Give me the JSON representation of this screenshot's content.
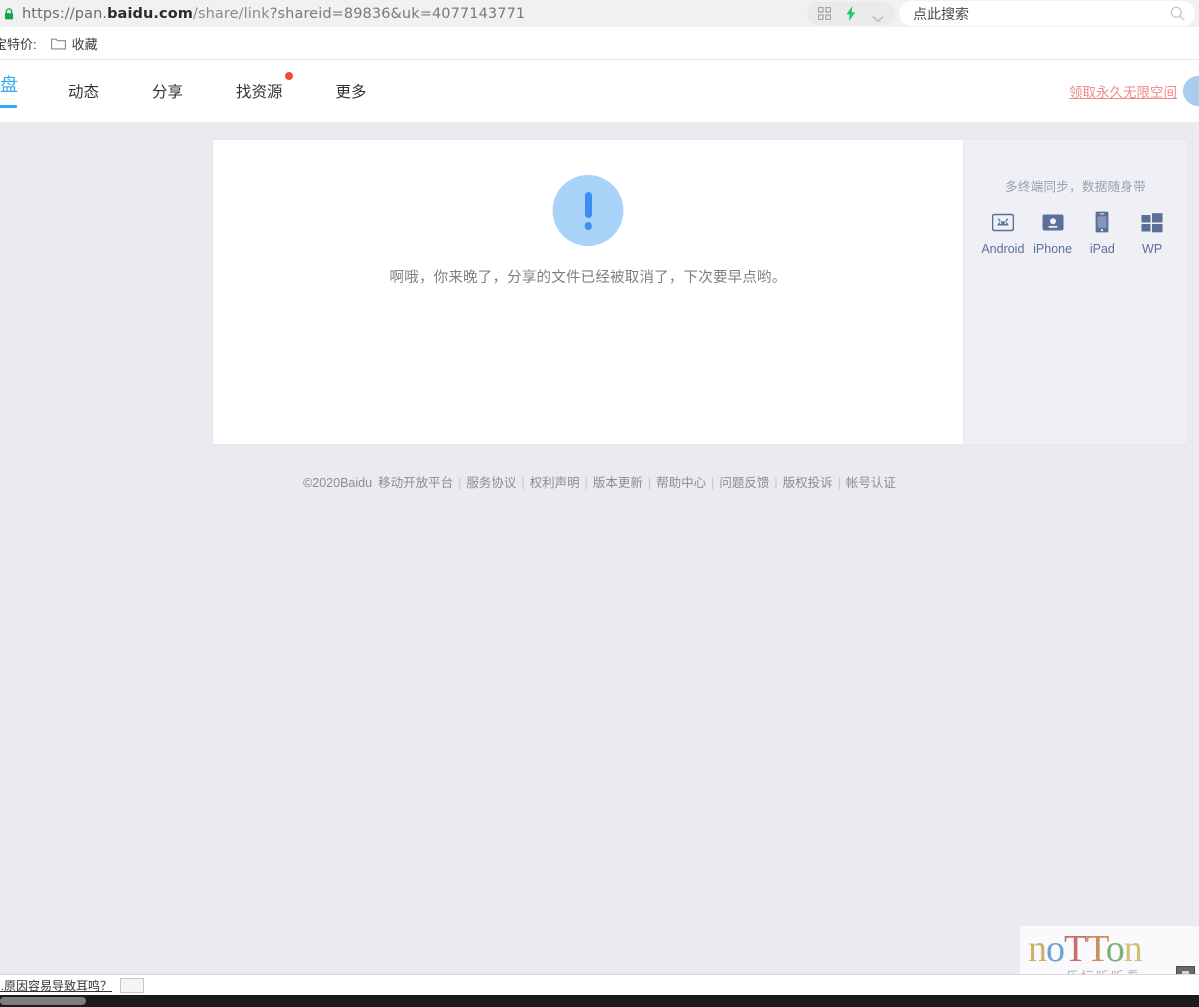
{
  "browser": {
    "url": {
      "scheme": "https://pan.",
      "domain": "baidu.com",
      "path": "/share/link",
      "query": "?shareid=89836&uk=4077143771",
      "full": "https://pan.baidu.com/share/link?shareid=89836&uk=4077143771"
    },
    "lock_icon": "secure-lock-icon",
    "omni_actions": {
      "qr_icon": "qr-code-icon",
      "bolt_icon": "lightning-bolt-icon",
      "chevron_icon": "chevron-down-icon"
    },
    "search": {
      "placeholder": "点此搜索",
      "icon": "search-magnifier-icon"
    },
    "bookmarks": [
      {
        "label": "宝特价:",
        "icon": null
      },
      {
        "label": "收藏",
        "icon": "folder-icon"
      }
    ]
  },
  "site_nav": {
    "brand": "盘",
    "items": [
      {
        "label": "动态",
        "badge": false
      },
      {
        "label": "分享",
        "badge": false
      },
      {
        "label": "找资源",
        "badge": true
      },
      {
        "label": "更多",
        "badge": false
      }
    ],
    "promo_link": "领取永久无限空间",
    "avatar": "user-avatar"
  },
  "main": {
    "error_icon": "exclamation-circle-icon",
    "error_message": "啊哦，你来晚了，分享的文件已经被取消了，下次要早点哟。"
  },
  "sidebar": {
    "title": "多终端同步，数据随身带",
    "devices": [
      {
        "label": "Android",
        "icon": "android-robot-icon"
      },
      {
        "label": "iPhone",
        "icon": "iphone-device-icon"
      },
      {
        "label": "iPad",
        "icon": "ipad-device-icon"
      },
      {
        "label": "WP",
        "icon": "windows-phone-icon"
      }
    ]
  },
  "footer": {
    "copyright": "©2020Baidu",
    "links": [
      "移动开放平台",
      "服务协议",
      "权利声明",
      "版本更新",
      "帮助中心",
      "问题反馈",
      "版权投诉",
      "帐号认证"
    ],
    "separator": "|"
  },
  "watermark": {
    "letters": [
      "n",
      "o",
      "T",
      "T",
      "o",
      "n"
    ],
    "subtitle": "乐坛听听看"
  },
  "status_bar": {
    "link_text": "...原因容易导致耳鸣？"
  },
  "colors": {
    "accent_blue": "#38a9f5",
    "error_icon_bg": "#a9d2f8",
    "error_icon_fg": "#3d8ef0",
    "badge_red": "#f04b3c",
    "promo_pink": "#f08a8a",
    "page_bg": "#eceaf0",
    "sidebar_bg": "#eef0f5",
    "device_icon": "#5b7099"
  }
}
